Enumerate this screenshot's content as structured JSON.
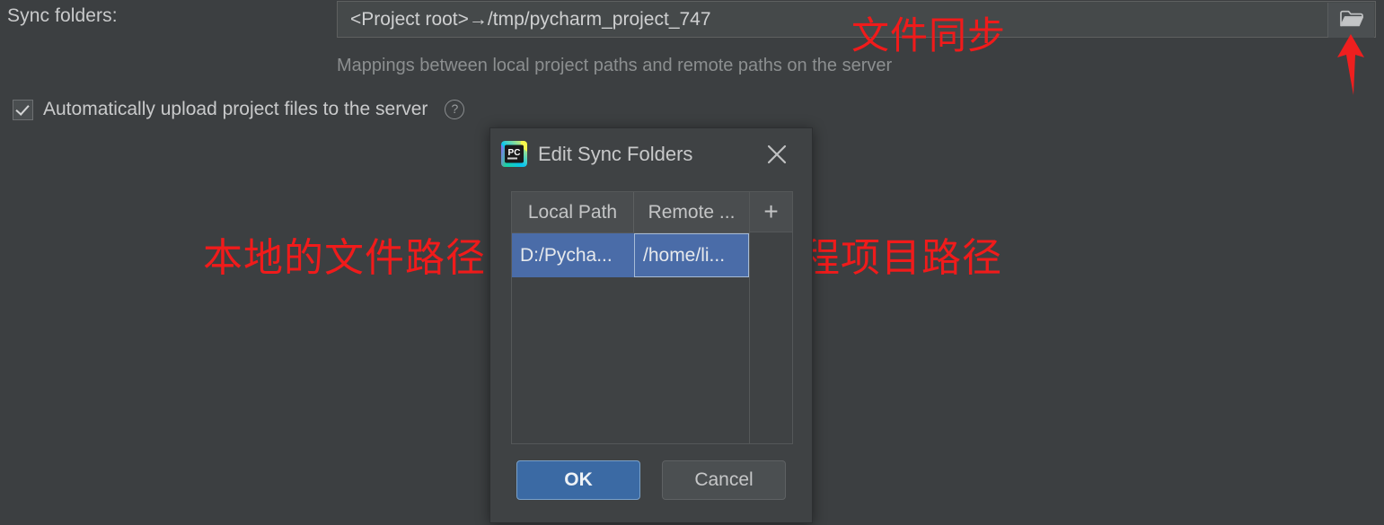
{
  "settings": {
    "sync_folders_label": "Sync folders:",
    "path_field": {
      "value": "<Project root>→/tmp/pycharm_project_747",
      "browse_icon": "folder-icon"
    },
    "hint": "Mappings between local project paths and remote paths on the server",
    "auto_upload": {
      "label": "Automatically upload project files to the server",
      "checked": true,
      "help_icon": "question-mark-icon"
    }
  },
  "annotations": {
    "color": "#f01b1b",
    "top": "文件同步",
    "left": "本地的文件路径",
    "right": "远程项目路径",
    "arrow": "red-up-arrow"
  },
  "dialog": {
    "title": "Edit Sync Folders",
    "app_icon": "pycharm-logo-icon",
    "close_icon": "close-icon",
    "table": {
      "columns": [
        "Local Path",
        "Remote ..."
      ],
      "add_button_label": "+",
      "rows": [
        {
          "local": "D:/Pycha...",
          "remote": "/home/li..."
        }
      ]
    },
    "buttons": {
      "ok": "OK",
      "cancel": "Cancel"
    },
    "accent_color": "#3b6aa4",
    "selection_color": "#4a6ca8"
  }
}
